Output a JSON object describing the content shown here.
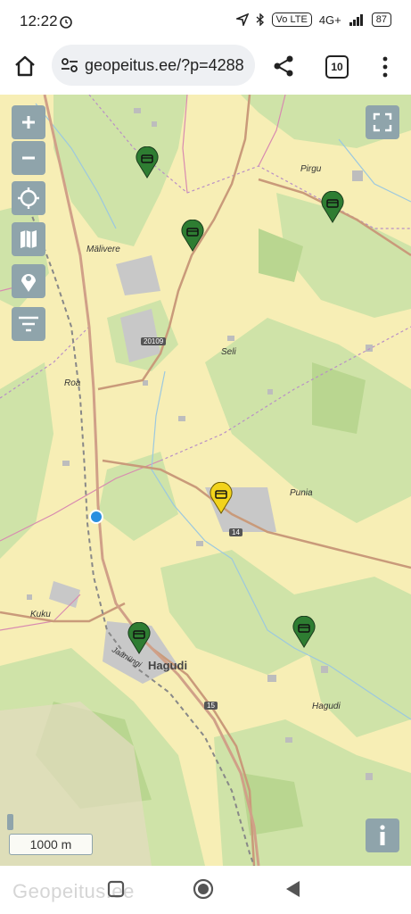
{
  "status": {
    "time": "12:22",
    "network": "4G+",
    "volte": "Vo LTE",
    "battery": "87"
  },
  "browser": {
    "url": "geopeitus.ee/?p=4288",
    "tab_count": "10"
  },
  "map": {
    "places": [
      {
        "name": "Pirgu"
      },
      {
        "name": "Mälivere"
      },
      {
        "name": "Seli"
      },
      {
        "name": "Roa"
      },
      {
        "name": "Punia"
      },
      {
        "name": "Kuku"
      },
      {
        "name": "Hagudi"
      },
      {
        "name": "Hagudi"
      }
    ],
    "road_numbers": [
      "20109",
      "14",
      "15"
    ],
    "street": "Jaanüngi",
    "scale_label": "1000 m",
    "markers": [
      {
        "color": "#2e7d32"
      },
      {
        "color": "#2e7d32"
      },
      {
        "color": "#2e7d32"
      },
      {
        "color": "#f2d31c"
      },
      {
        "color": "#2e7d32"
      },
      {
        "color": "#2e7d32"
      }
    ]
  },
  "controls": [
    "zoom-in",
    "zoom-out",
    "locate",
    "layers",
    "my-caches",
    "filter",
    "fullscreen",
    "info"
  ],
  "watermark": "Geopeitus.ee"
}
